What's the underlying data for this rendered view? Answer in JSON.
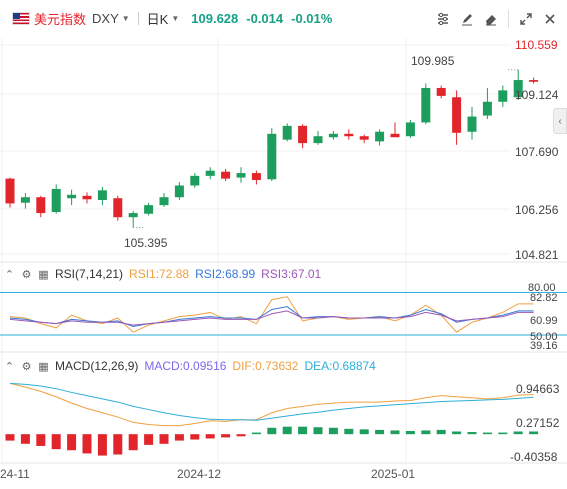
{
  "header": {
    "name": "美元指数",
    "code": "DXY",
    "timeframe": "日K",
    "price": "109.628",
    "change": "-0.014",
    "change_pct": "-0.01%",
    "tools": [
      "settings-icon",
      "pen-icon",
      "eraser-icon",
      "expand-icon",
      "close-icon"
    ]
  },
  "price_axis": [
    "110.559",
    "109.124",
    "107.690",
    "106.256",
    "104.821"
  ],
  "annotations": {
    "high": "109.985",
    "low": "105.395"
  },
  "rsi": {
    "title": "RSI(7,14,21)",
    "rsi1": "RSI1:72.88",
    "rsi2": "RSI2:68.99",
    "rsi3": "RSI3:67.01",
    "axis": [
      "80.00",
      "82.82",
      "60.99",
      "50.00",
      "39.16"
    ],
    "colors": {
      "rsi1": "#f0a040",
      "rsi2": "#3a78d8",
      "rsi3": "#9b59b6",
      "band": "#2eaed8"
    }
  },
  "macd": {
    "title": "MACD(12,26,9)",
    "macd": "MACD:0.09516",
    "dif": "DIF:0.73632",
    "dea": "DEA:0.68874",
    "axis": [
      "0.94663",
      "0.27152",
      "-0.40358"
    ],
    "colors": {
      "macd": "#7b68ee",
      "dif": "#f0a040",
      "dea": "#2eaed8"
    }
  },
  "x_axis": [
    "24-11",
    "2024-12",
    "2025-01"
  ],
  "colors": {
    "up": "#1e9e5e",
    "down": "#e2252b"
  },
  "chart_data": {
    "type": "candlestick",
    "ylim": [
      104.4,
      110.9
    ],
    "candles": [
      [
        106.82,
        106.85,
        105.98,
        106.1
      ],
      [
        106.12,
        106.4,
        105.95,
        106.28
      ],
      [
        106.28,
        106.32,
        105.7,
        105.82
      ],
      [
        105.85,
        106.65,
        105.8,
        106.52
      ],
      [
        106.25,
        106.5,
        106.05,
        106.35
      ],
      [
        106.32,
        106.42,
        106.1,
        106.22
      ],
      [
        106.2,
        106.58,
        106.05,
        106.48
      ],
      [
        106.25,
        106.32,
        105.6,
        105.7
      ],
      [
        105.7,
        105.88,
        105.4,
        105.82
      ],
      [
        105.8,
        106.12,
        105.75,
        106.05
      ],
      [
        106.05,
        106.4,
        106.0,
        106.28
      ],
      [
        106.28,
        106.72,
        106.2,
        106.62
      ],
      [
        106.62,
        106.98,
        106.55,
        106.9
      ],
      [
        106.9,
        107.15,
        106.8,
        107.05
      ],
      [
        107.02,
        107.1,
        106.75,
        106.82
      ],
      [
        106.85,
        107.15,
        106.7,
        106.98
      ],
      [
        106.98,
        107.05,
        106.65,
        106.78
      ],
      [
        106.8,
        108.28,
        106.75,
        108.12
      ],
      [
        107.95,
        108.42,
        107.9,
        108.35
      ],
      [
        108.35,
        108.4,
        107.7,
        107.85
      ],
      [
        107.85,
        108.2,
        107.8,
        108.05
      ],
      [
        108.02,
        108.2,
        107.95,
        108.12
      ],
      [
        108.12,
        108.25,
        107.95,
        108.05
      ],
      [
        108.05,
        108.1,
        107.85,
        107.95
      ],
      [
        107.9,
        108.25,
        107.78,
        108.18
      ],
      [
        108.12,
        108.45,
        108.05,
        108.02
      ],
      [
        108.05,
        108.52,
        108.0,
        108.45
      ],
      [
        108.45,
        109.58,
        108.4,
        109.45
      ],
      [
        109.45,
        109.52,
        109.15,
        109.22
      ],
      [
        109.18,
        109.38,
        107.8,
        108.15
      ],
      [
        108.18,
        108.9,
        107.95,
        108.62
      ],
      [
        108.65,
        109.45,
        108.55,
        109.05
      ],
      [
        109.05,
        109.52,
        108.9,
        109.38
      ],
      [
        109.18,
        109.98,
        109.1,
        109.68
      ],
      [
        109.68,
        109.75,
        109.58,
        109.63
      ]
    ],
    "rsi_series": [
      {
        "name": "RSI1",
        "values": [
          63,
          62,
          58,
          55,
          64,
          60,
          58,
          62,
          52,
          57,
          60,
          63,
          64,
          66,
          61,
          63,
          58,
          75,
          77,
          60,
          62,
          63,
          61,
          62,
          63,
          60,
          64,
          71,
          64,
          52,
          59,
          62,
          66,
          72,
          72
        ]
      },
      {
        "name": "RSI2",
        "values": [
          62,
          61,
          59,
          58,
          61,
          60,
          59,
          60,
          56,
          58,
          59,
          61,
          62,
          63,
          62,
          62,
          61,
          68,
          70,
          62,
          63,
          63,
          62,
          62,
          63,
          62,
          64,
          68,
          65,
          59,
          61,
          62,
          64,
          67,
          67
        ]
      },
      {
        "name": "RSI3",
        "values": [
          61,
          60,
          59,
          58,
          60,
          59,
          59,
          59,
          57,
          58,
          59,
          60,
          61,
          62,
          61,
          61,
          61,
          65,
          67,
          62,
          62,
          63,
          62,
          62,
          62,
          62,
          63,
          66,
          64,
          60,
          61,
          62,
          63,
          66,
          66
        ]
      }
    ],
    "dif": [
      0.95,
      0.88,
      0.8,
      0.7,
      0.58,
      0.48,
      0.4,
      0.32,
      0.22,
      0.18,
      0.16,
      0.16,
      0.2,
      0.25,
      0.24,
      0.27,
      0.27,
      0.4,
      0.48,
      0.52,
      0.56,
      0.58,
      0.6,
      0.6,
      0.6,
      0.62,
      0.63,
      0.68,
      0.72,
      0.7,
      0.68,
      0.66,
      0.68,
      0.73,
      0.74
    ],
    "dea": [
      0.95,
      0.93,
      0.9,
      0.85,
      0.78,
      0.72,
      0.66,
      0.6,
      0.52,
      0.46,
      0.4,
      0.35,
      0.31,
      0.28,
      0.27,
      0.27,
      0.26,
      0.3,
      0.34,
      0.38,
      0.41,
      0.45,
      0.48,
      0.51,
      0.53,
      0.55,
      0.57,
      0.59,
      0.61,
      0.62,
      0.63,
      0.64,
      0.65,
      0.67,
      0.69
    ],
    "macd_hist": [
      -0.12,
      -0.18,
      -0.22,
      -0.28,
      -0.3,
      -0.36,
      -0.4,
      -0.38,
      -0.3,
      -0.2,
      -0.18,
      -0.12,
      -0.1,
      -0.08,
      -0.06,
      -0.04,
      0.03,
      0.12,
      0.14,
      0.14,
      0.13,
      0.12,
      0.1,
      0.09,
      0.08,
      0.07,
      0.06,
      0.07,
      0.08,
      0.05,
      0.04,
      0.03,
      0.03,
      0.05,
      0.05
    ]
  }
}
